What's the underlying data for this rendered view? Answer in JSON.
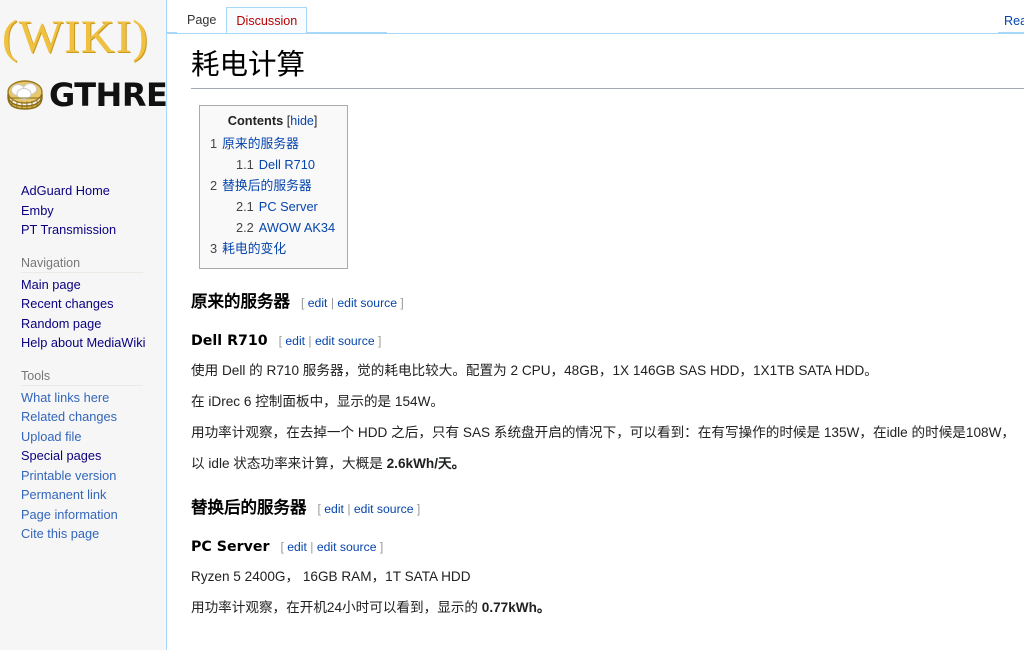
{
  "logo": {
    "wiki_text": "(WIKI)",
    "site_name": "GTHREE",
    "icon": "dumpling-steamer-icon"
  },
  "sidebar": {
    "groups": [
      {
        "heading": "",
        "items": [
          {
            "label": "AdGuard Home",
            "style": "visited"
          },
          {
            "label": "Emby",
            "style": "visited"
          },
          {
            "label": "PT Transmission",
            "style": "visited"
          }
        ]
      },
      {
        "heading": "Navigation",
        "items": [
          {
            "label": "Main page",
            "style": "visited"
          },
          {
            "label": "Recent changes",
            "style": "visited"
          },
          {
            "label": "Random page",
            "style": "visited"
          },
          {
            "label": "Help about MediaWiki",
            "style": "visited"
          }
        ]
      },
      {
        "heading": "Tools",
        "items": [
          {
            "label": "What links here",
            "style": "blue"
          },
          {
            "label": "Related changes",
            "style": "blue"
          },
          {
            "label": "Upload file",
            "style": "blue"
          },
          {
            "label": "Special pages",
            "style": "visited"
          },
          {
            "label": "Printable version",
            "style": "blue"
          },
          {
            "label": "Permanent link",
            "style": "blue"
          },
          {
            "label": "Page information",
            "style": "blue"
          },
          {
            "label": "Cite this page",
            "style": "blue"
          }
        ]
      }
    ]
  },
  "tabs": {
    "page": "Page",
    "discussion": "Discussion",
    "read_partial": "Rea"
  },
  "article": {
    "title": "耗电计算",
    "toc": {
      "title": "Contents",
      "toggle_open_bracket": "[",
      "toggle_label": "hide",
      "toggle_close_bracket": "]",
      "entries": [
        {
          "number": "1",
          "text": "原来的服务器",
          "level": 1
        },
        {
          "number": "1.1",
          "text": "Dell R710",
          "level": 2
        },
        {
          "number": "2",
          "text": "替换后的服务器",
          "level": 1
        },
        {
          "number": "2.1",
          "text": "PC Server",
          "level": 2
        },
        {
          "number": "2.2",
          "text": "AWOW AK34",
          "level": 2
        },
        {
          "number": "3",
          "text": "耗电的变化",
          "level": 1
        }
      ]
    },
    "editsection": {
      "open": "[",
      "edit": "edit",
      "sep": "|",
      "edit_source": "edit source",
      "close": "]"
    },
    "sections": [
      {
        "type": "h2",
        "heading": "原来的服务器"
      },
      {
        "type": "h3",
        "heading": "Dell R710"
      },
      {
        "type": "p",
        "text": "使用 Dell 的 R710 服务器，觉的耗电比较大。配置为 2 CPU，48GB，1X 146GB SAS HDD，1X1TB SATA HDD。"
      },
      {
        "type": "p",
        "text": "在 iDrec 6 控制面板中，显示的是 154W。"
      },
      {
        "type": "p",
        "text": "用功率计观察，在去掉一个 HDD 之后，只有 SAS 系统盘开启的情况下，可以看到：在有写操作的时候是 135W，在idle 的时候是108W，"
      },
      {
        "type": "p_bold_tail",
        "text": "以 idle 状态功率来计算，大概是 ",
        "bold": "2.6kWh/天。"
      },
      {
        "type": "h2",
        "heading": "替换后的服务器"
      },
      {
        "type": "h3",
        "heading": "PC Server"
      },
      {
        "type": "p",
        "text": "Ryzen 5 2400G， 16GB RAM，1T SATA HDD"
      },
      {
        "type": "p_bold_tail",
        "text": "用功率计观察，在开机24小时可以看到，显示的 ",
        "bold": "0.77kWh。"
      }
    ]
  },
  "colors": {
    "link": "#0645ad",
    "link_visited": "#0b0080",
    "new_link_red": "#bb0000",
    "logo_gold": "#f0c040",
    "sidebar_bg": "#f6f6f6",
    "border_blue": "#a7d7f9",
    "toc_border": "#aaaaaa",
    "toc_bg": "#f9f9f9"
  }
}
